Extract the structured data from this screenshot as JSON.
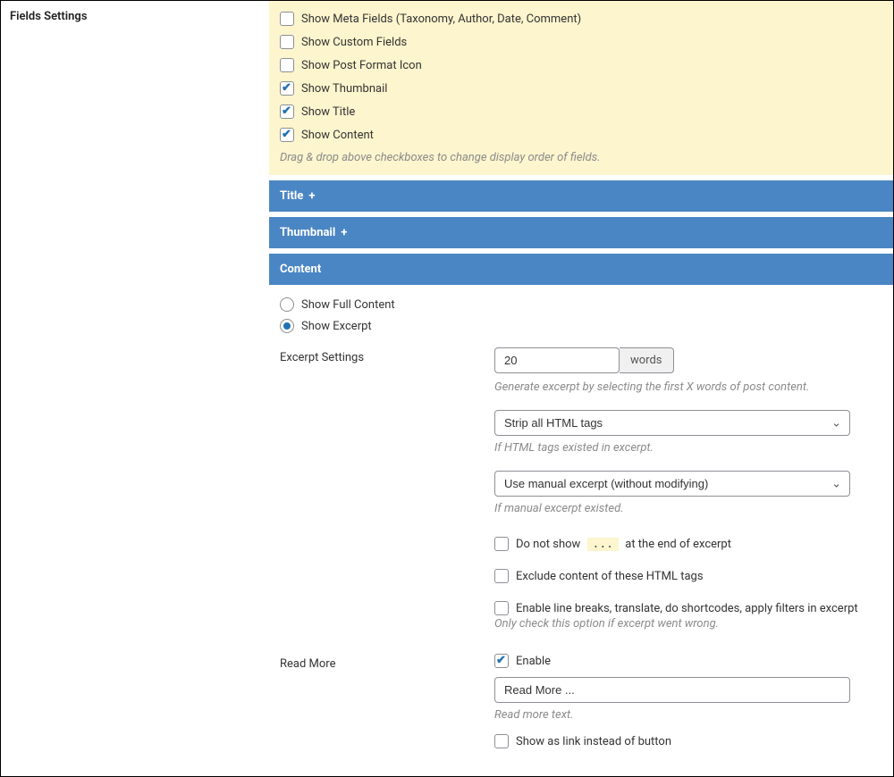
{
  "left": {
    "section_title": "Fields Settings"
  },
  "fields": {
    "show_meta": {
      "label": "Show Meta Fields (Taxonomy, Author, Date, Comment)",
      "checked": false
    },
    "show_custom": {
      "label": "Show Custom Fields",
      "checked": false
    },
    "show_postformat": {
      "label": "Show Post Format Icon",
      "checked": false
    },
    "show_thumbnail": {
      "label": "Show Thumbnail",
      "checked": true
    },
    "show_title": {
      "label": "Show Title",
      "checked": true
    },
    "show_content": {
      "label": "Show Content",
      "checked": true
    },
    "reorder_hint": "Drag & drop above checkboxes to change display order of fields."
  },
  "accordions": {
    "title": "Title",
    "thumbnail": "Thumbnail",
    "content": "Content"
  },
  "content_radio": {
    "full": "Show Full Content",
    "excerpt": "Show Excerpt"
  },
  "excerpt": {
    "heading": "Excerpt Settings",
    "value": "20",
    "unit": "words",
    "gen_hint": "Generate excerpt by selecting the first X words of post content.",
    "strip_select": "Strip all HTML tags",
    "strip_hint": "If HTML tags existed in excerpt.",
    "manual_select": "Use manual excerpt (without modifying)",
    "manual_hint": "If manual excerpt existed.",
    "dots_prefix": "Do not show",
    "dots_badge": "...",
    "dots_suffix": "at the end of excerpt",
    "exclude_label": "Exclude content of these HTML tags",
    "linebreaks_label": "Enable line breaks, translate, do shortcodes, apply filters in excerpt",
    "linebreaks_hint": "Only check this option if excerpt went wrong."
  },
  "readmore": {
    "heading": "Read More",
    "enable_label": "Enable",
    "text_value": "Read More ...",
    "text_hint": "Read more text.",
    "link_label": "Show as link instead of button"
  }
}
